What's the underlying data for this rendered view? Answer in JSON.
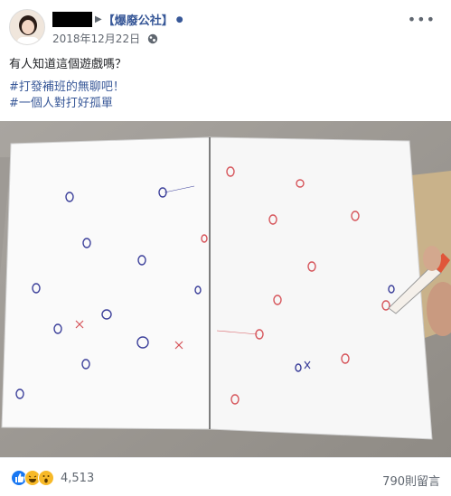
{
  "post": {
    "page_name": "【爆廢公社】",
    "timestamp": "2018年12月22日",
    "privacy_icon": "globe-icon",
    "text": "有人知道這個遊戲嗎？",
    "hashtags": [
      "#打發補班的無聊吧！",
      "#一個人對打好孤單"
    ]
  },
  "footer": {
    "reactions": [
      "like-icon",
      "haha-icon",
      "wow-icon"
    ],
    "reaction_count": "4,513",
    "comment_count": "790則留言"
  },
  "colors": {
    "link": "#385898",
    "meta": "#616770",
    "like": "#1877f2",
    "haha": "#f7b928"
  }
}
